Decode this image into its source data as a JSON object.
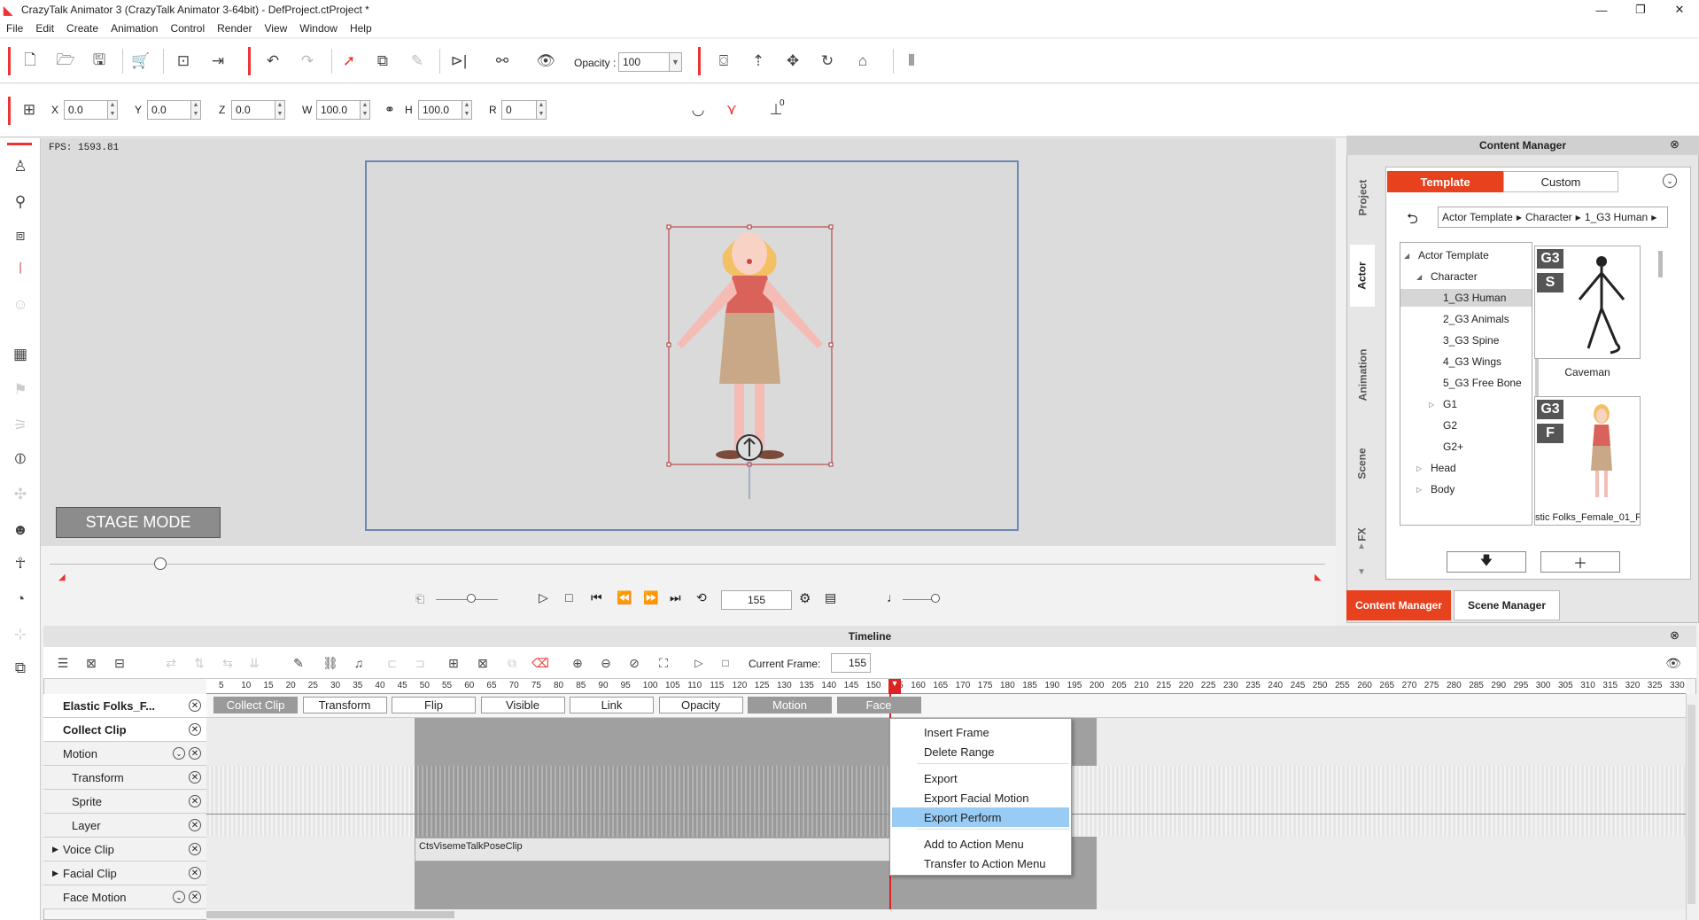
{
  "window": {
    "title": "CrazyTalk Animator 3  (CrazyTalk Animator 3-64bit) - DefProject.ctProject *",
    "controls": [
      "—",
      "❐",
      "✕"
    ]
  },
  "menu": [
    "File",
    "Edit",
    "Create",
    "Animation",
    "Control",
    "Render",
    "View",
    "Window",
    "Help"
  ],
  "toolbar": {
    "opacity_label": "Opacity :",
    "opacity_value": "100"
  },
  "transform": {
    "x_label": "X",
    "x_value": "0.0",
    "y_label": "Y",
    "y_value": "0.0",
    "z_label": "Z",
    "z_value": "0.0",
    "w_label": "W",
    "w_value": "100.0",
    "h_label": "H",
    "h_value": "100.0",
    "r_label": "R",
    "r_value": "0",
    "angle_value": "0"
  },
  "viewport": {
    "fps": "FPS: 1593.81",
    "stage_mode": "STAGE MODE"
  },
  "playback": {
    "frame": "155"
  },
  "content_manager": {
    "title": "Content Manager",
    "vtabs": [
      "Project",
      "Actor",
      "Animation",
      "Scene",
      "FX"
    ],
    "tab_template": "Template",
    "tab_custom": "Custom",
    "breadcrumb": [
      "Actor Template",
      "Character",
      "1_G3 Human"
    ],
    "tree": [
      {
        "label": "Actor Template",
        "level": 0,
        "arrow": "◢"
      },
      {
        "label": "Character",
        "level": 1,
        "arrow": "◢"
      },
      {
        "label": "1_G3 Human",
        "level": 2,
        "arrow": "",
        "selected": true
      },
      {
        "label": "2_G3 Animals",
        "level": 2,
        "arrow": ""
      },
      {
        "label": "3_G3 Spine",
        "level": 2,
        "arrow": ""
      },
      {
        "label": "4_G3 Wings",
        "level": 2,
        "arrow": ""
      },
      {
        "label": "5_G3 Free Bone",
        "level": 2,
        "arrow": ""
      },
      {
        "label": "G1",
        "level": 2,
        "arrow": "▷"
      },
      {
        "label": "G2",
        "level": 2,
        "arrow": ""
      },
      {
        "label": "G2+",
        "level": 2,
        "arrow": ""
      },
      {
        "label": "Head",
        "level": 1,
        "arrow": "▷"
      },
      {
        "label": "Body",
        "level": 1,
        "arrow": "▷"
      }
    ],
    "thumbs": [
      {
        "badge1": "G3",
        "badge2": "S",
        "caption": "Caveman"
      },
      {
        "badge1": "G3",
        "badge2": "F",
        "caption": "stic Folks_Female_01_F"
      }
    ],
    "bottom_tab_cm": "Content Manager",
    "bottom_tab_sm": "Scene Manager"
  },
  "timeline": {
    "title": "Timeline",
    "current_frame_label": "Current Frame:",
    "current_frame_value": "155",
    "ruler": [
      "5",
      "10",
      "15",
      "20",
      "25",
      "30",
      "35",
      "40",
      "45",
      "50",
      "55",
      "60",
      "65",
      "70",
      "75",
      "80",
      "85",
      "90",
      "95",
      "100",
      "105",
      "110",
      "115",
      "120",
      "125",
      "130",
      "135",
      "140",
      "145",
      "150",
      "155",
      "160",
      "165",
      "170",
      "175",
      "180",
      "185",
      "190",
      "195",
      "200",
      "205",
      "210",
      "215",
      "220",
      "225",
      "230",
      "235",
      "240",
      "245",
      "250",
      "255",
      "260",
      "265",
      "270",
      "275",
      "280",
      "285",
      "290",
      "295",
      "300",
      "305",
      "310",
      "315",
      "320",
      "325",
      "330"
    ],
    "tracks": [
      {
        "label": "Elastic Folks_F...",
        "bold": true,
        "indent": 10,
        "expand": "",
        "dd": false
      },
      {
        "label": "Collect Clip",
        "bold": true,
        "indent": 10,
        "expand": "",
        "dd": false
      },
      {
        "label": "Motion",
        "bold": false,
        "indent": 10,
        "expand": "",
        "dd": true
      },
      {
        "label": "Transform",
        "bold": false,
        "indent": 20,
        "expand": "",
        "dd": false
      },
      {
        "label": "Sprite",
        "bold": false,
        "indent": 20,
        "expand": "",
        "dd": false
      },
      {
        "label": "Layer",
        "bold": false,
        "indent": 20,
        "expand": "",
        "dd": false
      },
      {
        "label": "Voice Clip",
        "bold": false,
        "indent": 10,
        "expand": "▶",
        "dd": false
      },
      {
        "label": "Facial Clip",
        "bold": false,
        "indent": 10,
        "expand": "▶",
        "dd": false
      },
      {
        "label": "Face Motion",
        "bold": false,
        "indent": 10,
        "expand": "",
        "dd": true
      }
    ],
    "chips": [
      "Collect Clip",
      "Transform",
      "Flip",
      "Visible",
      "Link",
      "Opacity",
      "Motion",
      "Face"
    ],
    "voice_clip_name": "CtsVisemeTalkPoseClip"
  },
  "context_menu": {
    "items": [
      {
        "label": "Insert Frame",
        "selected": false
      },
      {
        "label": "Delete Range",
        "selected": false
      },
      {
        "label": "Export",
        "selected": false
      },
      {
        "label": "Export Facial Motion",
        "selected": false
      },
      {
        "label": "Export Perform",
        "selected": true
      },
      {
        "label": "Add to Action Menu",
        "selected": false
      },
      {
        "label": "Transfer to Action Menu",
        "selected": false
      }
    ]
  }
}
